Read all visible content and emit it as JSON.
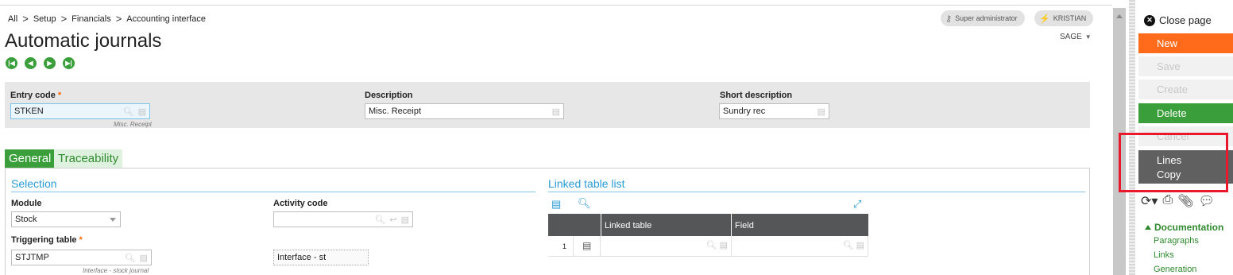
{
  "breadcrumb": [
    "All",
    "Setup",
    "Financials",
    "Accounting interface"
  ],
  "page_title": "Automatic journals",
  "user_pills": {
    "role": "Super administrator",
    "user": "KRISTIAN"
  },
  "folder": "SAGE",
  "header": {
    "entry_code": {
      "label": "Entry code",
      "value": "STKEN",
      "hint": "Misc. Receipt"
    },
    "description": {
      "label": "Description",
      "value": "Misc. Receipt"
    },
    "short_description": {
      "label": "Short description",
      "value": "Sundry rec"
    }
  },
  "tabs": [
    "General",
    "Traceability"
  ],
  "selection": {
    "title": "Selection",
    "module": {
      "label": "Module",
      "value": "Stock"
    },
    "activity_code": {
      "label": "Activity code",
      "value": ""
    },
    "triggering_table": {
      "label": "Triggering table",
      "value": "STJTMP",
      "hint": "Interface - stock journal"
    },
    "interface_text": "Interface - st"
  },
  "linked_table_list": {
    "title": "Linked table list",
    "columns": [
      "Linked table",
      "Field"
    ],
    "rows": [
      {
        "num": "1",
        "linked_table": "",
        "field": ""
      }
    ]
  },
  "right_panel": {
    "close_page": "Close page",
    "actions": {
      "new": "New",
      "save": "Save",
      "create": "Create",
      "delete": "Delete",
      "cancel": "Cancel",
      "lines": "Lines",
      "copy": "Copy"
    },
    "documentation": {
      "title": "Documentation",
      "links": [
        "Paragraphs",
        "Links",
        "Generation"
      ]
    }
  },
  "colors": {
    "accent_green": "#3a9f3a",
    "accent_orange": "#ff6b1a",
    "accent_blue": "#2a9bd5",
    "highlight_red": "#e8192c"
  }
}
